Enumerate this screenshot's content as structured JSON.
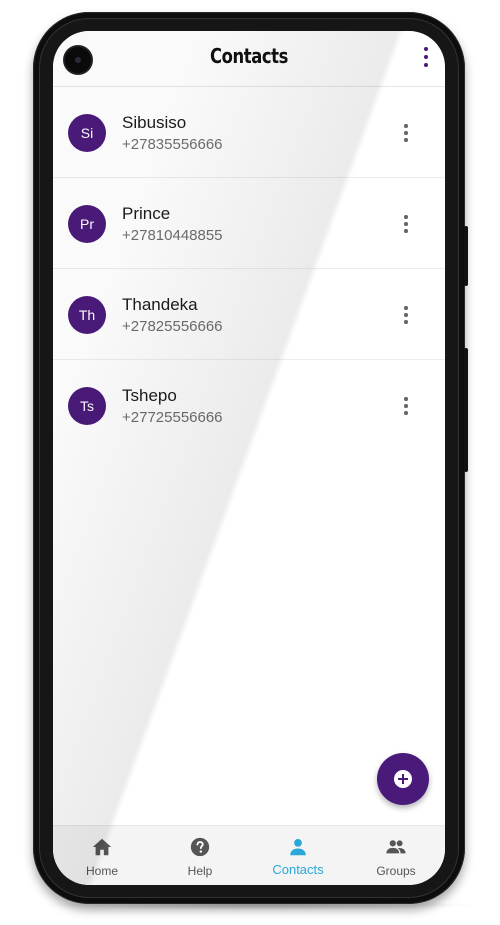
{
  "appbar": {
    "title": "Contacts",
    "menu_icon": "more-vert-icon"
  },
  "contacts": [
    {
      "initials": "Si",
      "name": "Sibusiso",
      "phone": "+27835556666"
    },
    {
      "initials": "Pr",
      "name": "Prince",
      "phone": "+27810448855"
    },
    {
      "initials": "Th",
      "name": "Thandeka",
      "phone": "+27825556666"
    },
    {
      "initials": "Ts",
      "name": "Tshepo",
      "phone": "+27725556666"
    }
  ],
  "fab": {
    "icon": "add-circle-icon"
  },
  "bottom_nav": {
    "items": [
      {
        "label": "Home",
        "icon": "home-icon"
      },
      {
        "label": "Help",
        "icon": "help-icon"
      },
      {
        "label": "Contacts",
        "icon": "person-icon"
      },
      {
        "label": "Groups",
        "icon": "groups-icon"
      }
    ],
    "active": "Contacts"
  },
  "colors": {
    "brand_purple": "#4a1a7a",
    "active_tab": "#2aa8d8",
    "muted_text": "#6e6e6e"
  }
}
